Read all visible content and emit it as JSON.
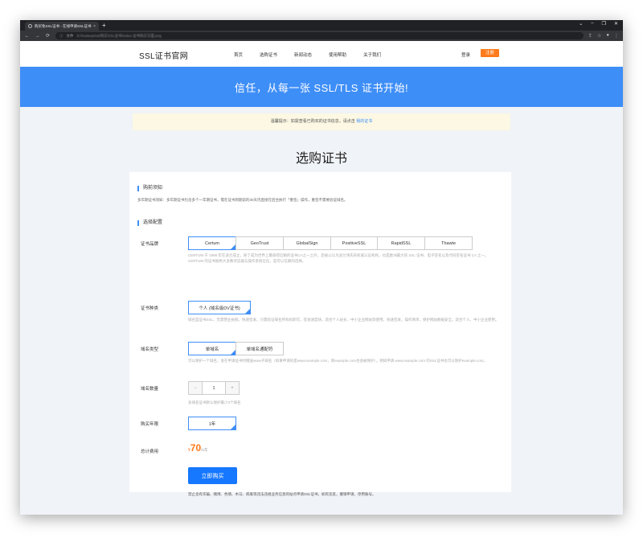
{
  "browser": {
    "tab_title": "购买免SSL证书 - 在线申请SSL证书",
    "tab_close": "×",
    "new_tab": "+",
    "secure_label": "文件",
    "url": "D:/hostexp/ssl/购买SSL证书/index-证书购买页面.png",
    "window_controls": [
      "⌄",
      "–",
      "❐",
      "✕"
    ],
    "nav_icons": [
      "←",
      "→",
      "⟳",
      "ⓘ"
    ],
    "right_icons": [
      "⇪",
      "☆",
      "●",
      "⋮"
    ]
  },
  "header": {
    "logo": "SSL证书官网",
    "nav": [
      "首页",
      "选购证书",
      "新闻动态",
      "使用帮助",
      "关于我们"
    ],
    "login": "登录",
    "register": "注册"
  },
  "banner": {
    "text": "信任，从每一张 SSL/TLS 证书开始!"
  },
  "notice": {
    "prefix": "温馨提示：如需查看已购买的证书信息，请点击 ",
    "link": "我的证书"
  },
  "page_title": "选购证书",
  "purchase_notice": {
    "title": "购前须知",
    "text": "多年期证书须知：多年期证书包含多个一年期证书，需在证书到期前的30天内直接在后台执行「重签」操作，重签不需要验证域名。"
  },
  "config": {
    "title": "选择配置",
    "brand": {
      "label": "证书品牌",
      "options": [
        "Certum",
        "GeoTrust",
        "GlobalSign",
        "PositiveSSL",
        "RapidSSL",
        "Thawte"
      ],
      "selected_index": 0,
      "description": "CERTUM 于 1998 年在波兰成立，除了成为世界上最值得信赖的证书CA之一之外，还被公认为波兰领先的权威认证机构，也是欧洲最大的 SSL 证书、电子签名以及代码签名证书 CA 之一。CERTUM 的证书被绝大多数浏览器与操作系统信任，是可以信赖的选择。"
    },
    "type": {
      "label": "证书种类",
      "option": "个人 (域名级DV证书)",
      "description": "域名型证书SSL，无需营业执照，快速签发。只需验证域名所有权即可，签发速度快，适合个人站长、中小企业网站等使用。快速签发，操作简单，保护网站数据安全。适合个人、中小企业使用。"
    },
    "domain_type": {
      "label": "域名类型",
      "options": [
        "单域名",
        "单域名通配符"
      ],
      "selected_index": 0,
      "description": "可以保护一个域名，会在申请证书时赠送www子域名（如果申请的是www.example.com，则example.com也会被保护）。例如申请 www.example.com 的SSL证书也可以保护example.com。"
    },
    "quantity": {
      "label": "域名数量",
      "minus": "−",
      "value": "1",
      "plus": "+",
      "note": "多域名证书默认保护最少3个域名"
    },
    "period": {
      "label": "购买年限",
      "option": "1年"
    },
    "total": {
      "label": "总计费用",
      "currency": "¥",
      "amount": "70",
      "unit": "/1年"
    },
    "buy_button": "立即购买",
    "footnote": "禁止含有诈骗、赌博、色情、木马、病毒等违法违规业务信息的站点申请SSL证书，如有违反，撤销申请，停用账号。"
  }
}
